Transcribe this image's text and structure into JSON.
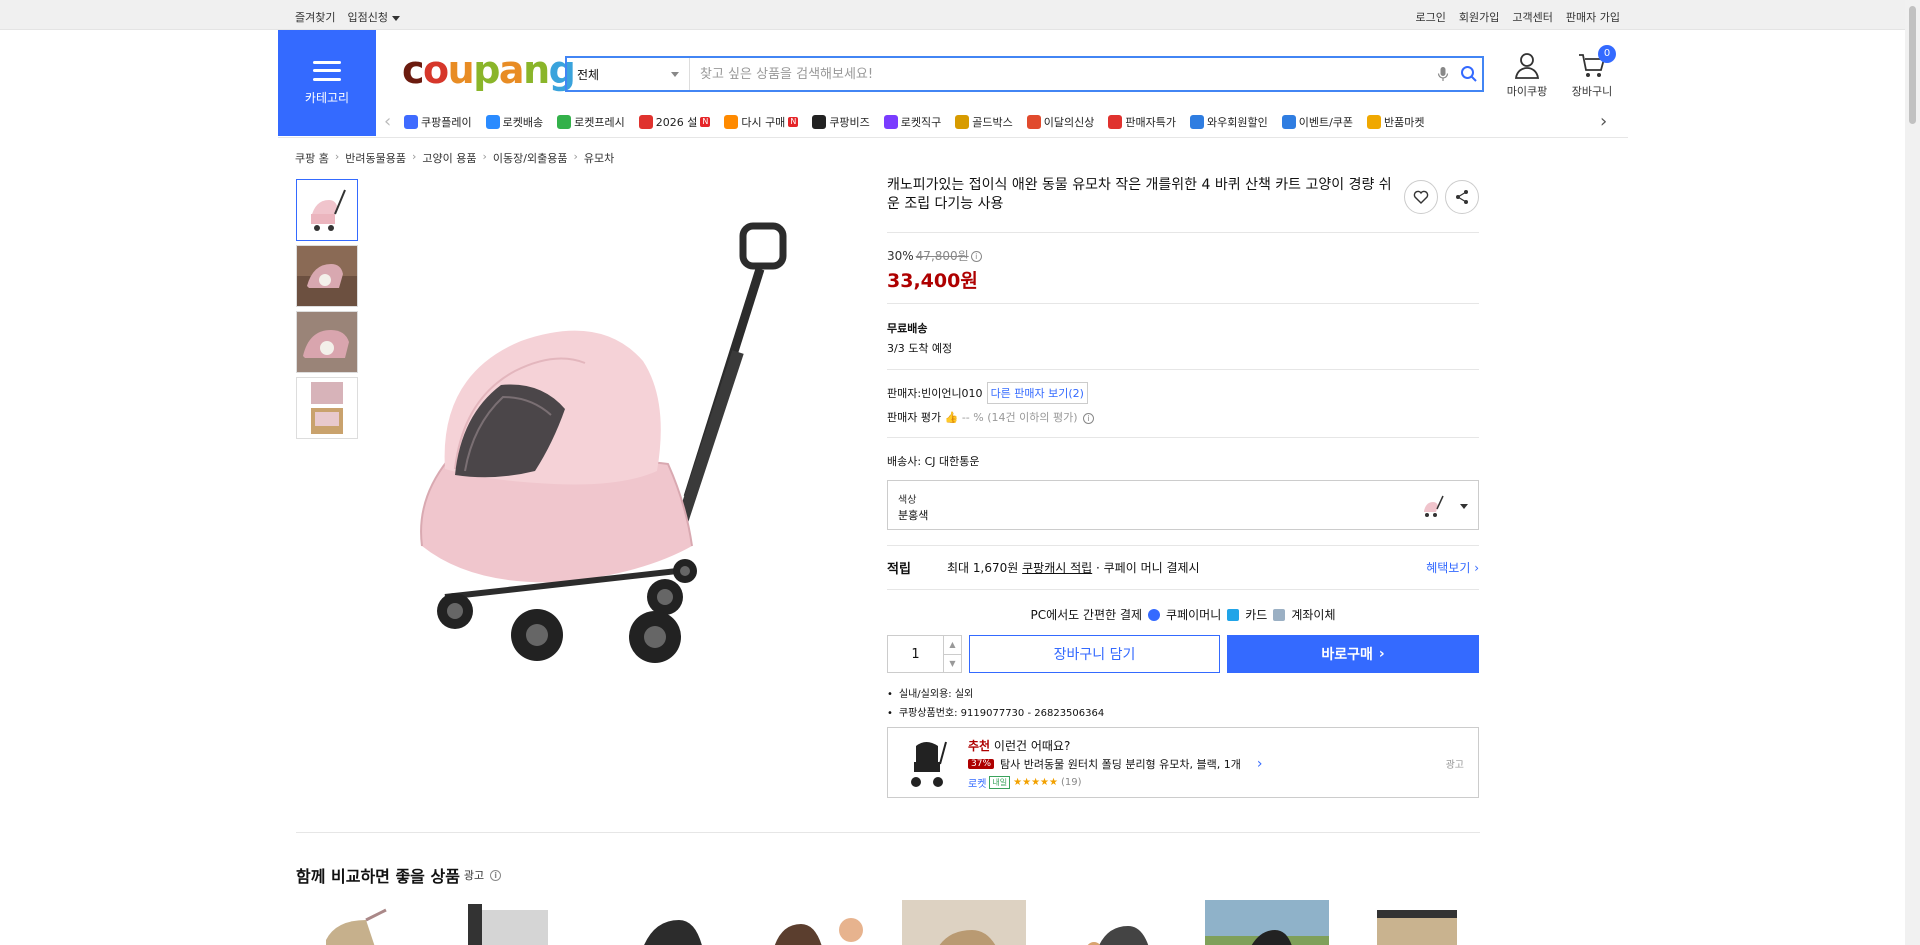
{
  "topbar": {
    "left": [
      "즐겨찾기",
      "입점신청"
    ],
    "right": [
      "로그인",
      "회원가입",
      "고객센터",
      "판매자 가입"
    ]
  },
  "header": {
    "category_label": "카테고리",
    "logo": "coupang",
    "search_scope": "전체",
    "search_placeholder": "찾고 싶은 상품을 검색해보세요!",
    "my_coupang": "마이쿠팡",
    "cart_label": "장바구니",
    "cart_count": "0"
  },
  "nav": [
    {
      "label": "쿠팡플레이",
      "icon": "play-icon",
      "color": "#3f6bff"
    },
    {
      "label": "로켓배송",
      "icon": "rocket-icon",
      "color": "#2a8bff"
    },
    {
      "label": "로켓프레시",
      "icon": "rocket-fresh-icon",
      "color": "#33b14a"
    },
    {
      "label": "2026 설",
      "icon": "hanbok-icon",
      "color": "#e0322e",
      "badge": "N"
    },
    {
      "label": "다시 구매",
      "icon": "repurchase-icon",
      "color": "#ff8a00",
      "badge": "N"
    },
    {
      "label": "쿠팡비즈",
      "icon": "biz-icon",
      "color": "#222222"
    },
    {
      "label": "로켓직구",
      "icon": "global-rocket-icon",
      "color": "#7a3cff"
    },
    {
      "label": "골드박스",
      "icon": "goldbox-icon",
      "color": "#d79b00"
    },
    {
      "label": "이달의신상",
      "icon": "new-icon",
      "color": "#e14a2d"
    },
    {
      "label": "판매자특가",
      "icon": "seller-deal-icon",
      "color": "#e0322e"
    },
    {
      "label": "와우회원할인",
      "icon": "wow-icon",
      "color": "#2f7de1"
    },
    {
      "label": "이벤트/쿠폰",
      "icon": "coupon-icon",
      "color": "#2f7de1"
    },
    {
      "label": "반품마켓",
      "icon": "return-market-icon",
      "color": "#f0a800"
    }
  ],
  "breadcrumb": [
    "쿠팡 홈",
    "반려동물용품",
    "고양이 용품",
    "이동장/외출용품",
    "유모차"
  ],
  "product": {
    "title": "캐노피가있는 접이식 애완 동물 유모차 작은 개를위한 4 바퀴 산책 카트 고양이 경량 쉬운 조립 다기능 사용",
    "discount": "30%",
    "original_price": "47,800원",
    "price": "33,400원",
    "shipping_title": "무료배송",
    "shipping_eta": "3/3 도착 예정",
    "seller_label": "판매자:",
    "seller_name": "빈이언니010",
    "other_sellers": "다른 판매자 보기(2)",
    "rating_label": "판매자 평가",
    "rating_value": "-- %",
    "rating_note": "(14건 이하의 평가)",
    "courier_label": "배송사:",
    "courier_name": "CJ 대한통운",
    "option_key": "색상",
    "option_value": "분홍색",
    "reward_key": "적립",
    "reward_max": "최대 1,670원",
    "reward_cash": "쿠팡캐시 적립",
    "reward_tail": "· 쿠페이 머니 결제시",
    "benefit_link": "혜택보기",
    "pay_title": "PC에서도 간편한 결제",
    "pay_methods": [
      "쿠페이머니",
      "카드",
      "계좌이체"
    ],
    "qty": "1",
    "add_cart": "장바구니 담기",
    "buy_now": "바로구매",
    "specs": [
      "실내/실외용: 실외",
      "쿠팡상품번호: 9119077730 - 26823506364"
    ]
  },
  "recommend": {
    "label_red": "추천",
    "label": "이런건 어때요?",
    "discount": "37%",
    "name": "탐사 반려동물 원터치 폴딩 분리형 유모차, 블랙, 1개",
    "delivery": "로켓",
    "delivery_tag": "내일",
    "stars": "★★★★★",
    "reviews": "(19)",
    "ad": "광고"
  },
  "compare": {
    "title": "함께 비교하면 좋을 상품",
    "ad": "광고"
  }
}
